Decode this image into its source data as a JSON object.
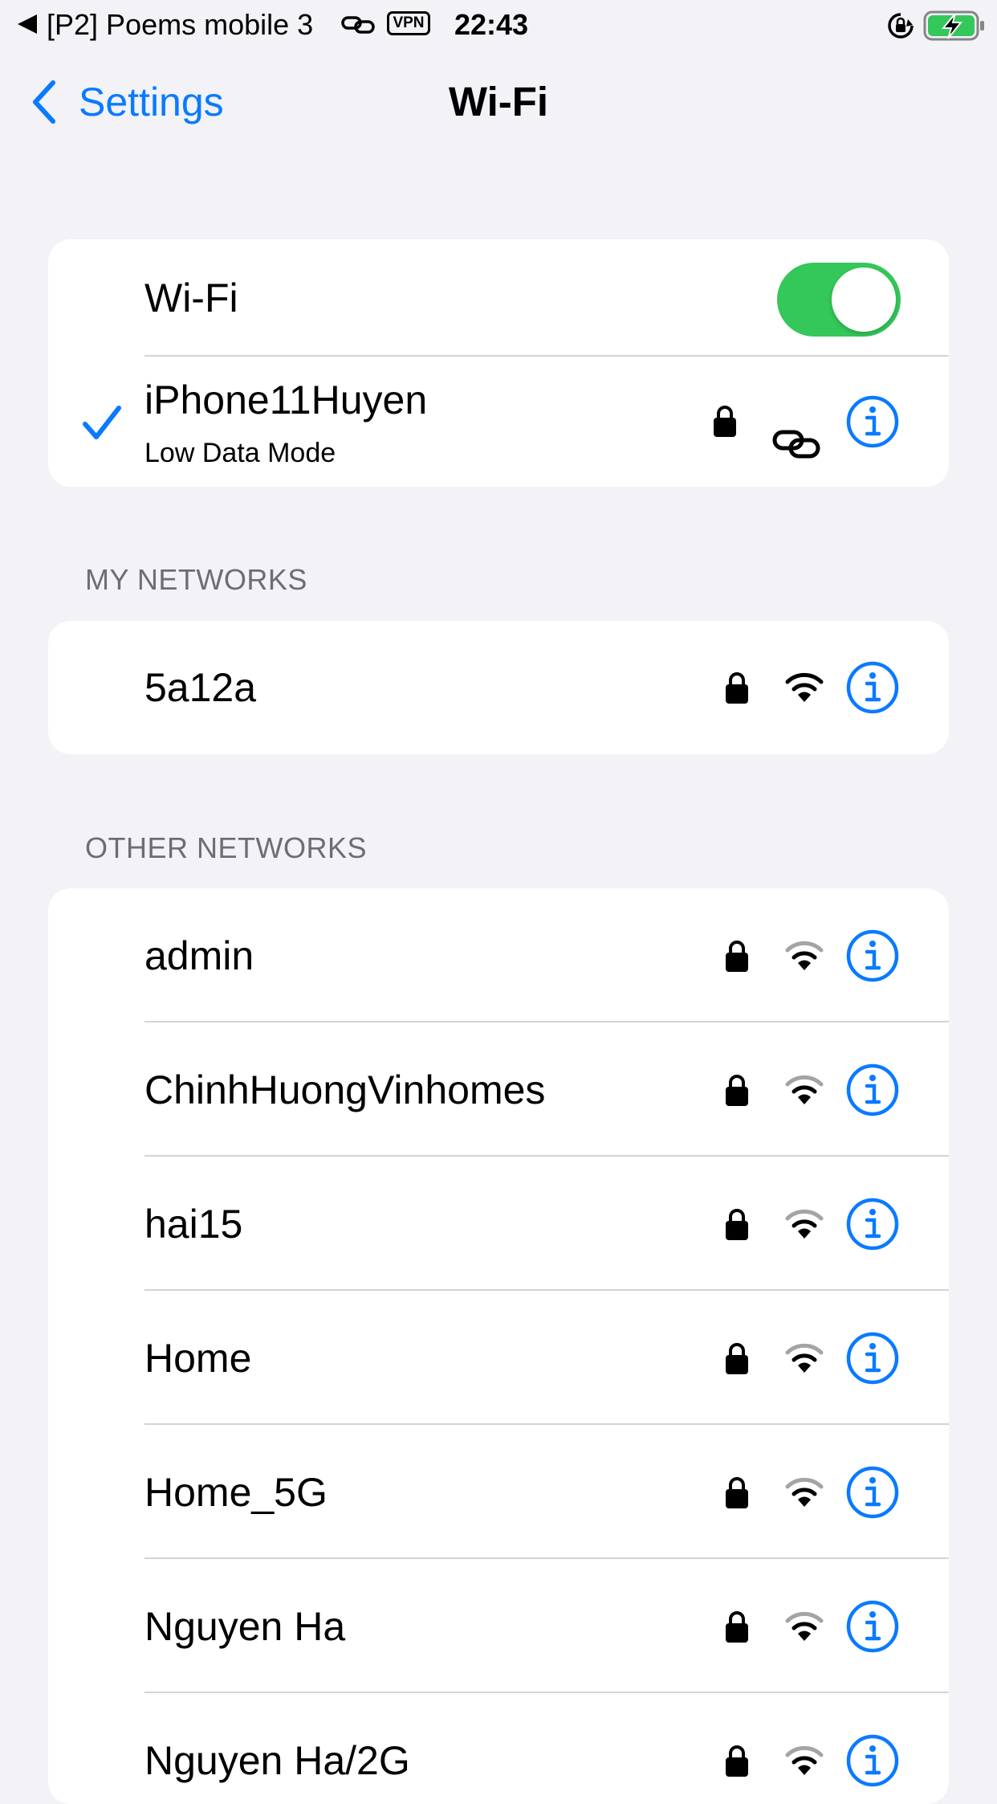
{
  "status_bar": {
    "back_app": "[P2] Poems mobile 3",
    "vpn": "VPN",
    "time": "22:43"
  },
  "nav": {
    "back_label": "Settings",
    "title": "Wi-Fi"
  },
  "wifi_toggle": {
    "label": "Wi-Fi",
    "on": true,
    "on_color": "#34c759"
  },
  "connected": {
    "name": "iPhone11Huyen",
    "subtitle": "Low Data Mode",
    "icons": [
      "checkmark-icon",
      "lock-icon",
      "personal-hotspot-link-icon",
      "info-icon"
    ]
  },
  "my_networks": {
    "header": "MY NETWORKS",
    "items": [
      {
        "name": "5a12a"
      }
    ]
  },
  "other_networks": {
    "header": "OTHER NETWORKS",
    "items": [
      {
        "name": "admin"
      },
      {
        "name": "ChinhHuongVinhomes"
      },
      {
        "name": "hai15"
      },
      {
        "name": "Home"
      },
      {
        "name": "Home_5G"
      },
      {
        "name": "Nguyen Ha"
      },
      {
        "name": "Nguyen Ha/2G"
      }
    ]
  },
  "colors": {
    "accent": "#0a7aff",
    "background": "#f2f2f7",
    "section_header": "#6d6d72"
  }
}
